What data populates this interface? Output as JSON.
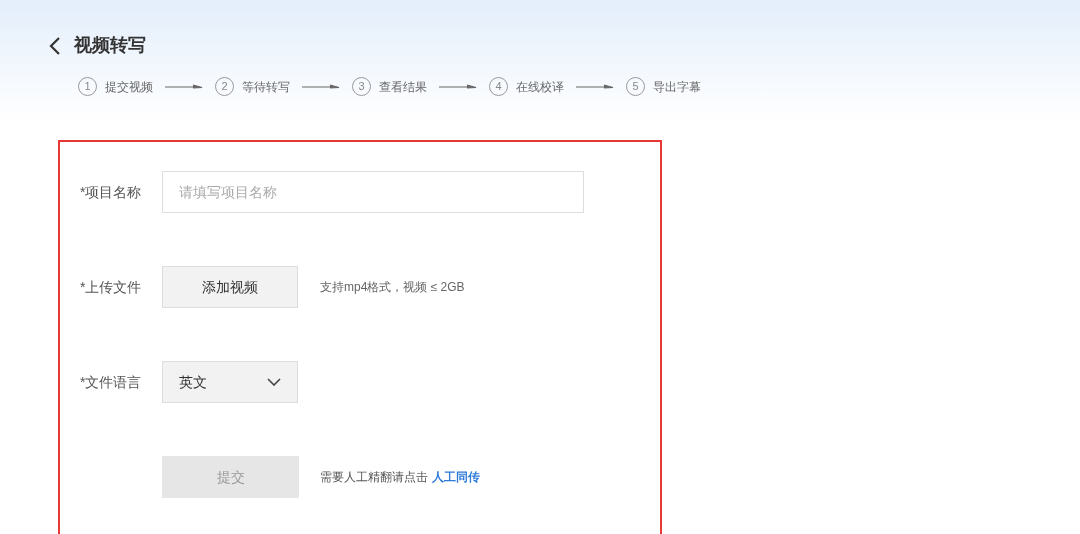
{
  "header": {
    "title": "视频转写"
  },
  "steps": [
    {
      "number": "1",
      "label": "提交视频"
    },
    {
      "number": "2",
      "label": "等待转写"
    },
    {
      "number": "3",
      "label": "查看结果"
    },
    {
      "number": "4",
      "label": "在线校译"
    },
    {
      "number": "5",
      "label": "导出字幕"
    }
  ],
  "form": {
    "name_label": "*项目名称",
    "name_placeholder": "请填写项目名称",
    "upload_label": "*上传文件",
    "upload_button": "添加视频",
    "upload_hint": "支持mp4格式，视频 ≤ 2GB",
    "language_label": "*文件语言",
    "language_value": "英文",
    "submit": {
      "label": "提交",
      "disabled": true
    },
    "note": "需要人工精翻请点击",
    "note_link": "人工同传"
  }
}
